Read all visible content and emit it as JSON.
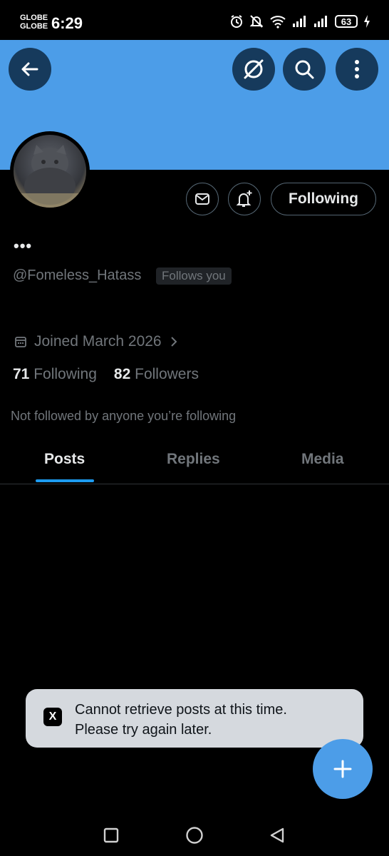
{
  "status_bar": {
    "carrier_1": "GLOBE",
    "carrier_2": "GLOBE",
    "time": "6:29",
    "battery": "63",
    "icons": [
      "alarm-icon",
      "mute-icon",
      "wifi-icon",
      "signal-icon",
      "signal-icon",
      "battery-icon",
      "charging-icon"
    ]
  },
  "header": {
    "banner_color": "#4c9de8",
    "icons": [
      "back-arrow-icon",
      "grok-icon",
      "search-icon",
      "more-vertical-icon"
    ]
  },
  "profile": {
    "display_name": "•••",
    "handle": "@Fomeless_Hatass",
    "follows_you": "Follows you",
    "joined": "Joined March 2026",
    "following_count": "71",
    "following_label": "Following",
    "followers_count": "82",
    "followers_label": "Followers",
    "not_followed": "Not followed by anyone you’re following",
    "following_button": "Following"
  },
  "tabs": [
    {
      "label": "Posts",
      "active": true
    },
    {
      "label": "Replies",
      "active": false
    },
    {
      "label": "Media",
      "active": false
    }
  ],
  "toast": {
    "logo": "X",
    "line1": "Cannot retrieve posts at this time.",
    "line2": "Please try again later."
  },
  "colors": {
    "accent": "#1d9bf0",
    "fab": "#4c9de8",
    "muted_text": "#71767b",
    "toast_bg": "#d5d9de"
  }
}
